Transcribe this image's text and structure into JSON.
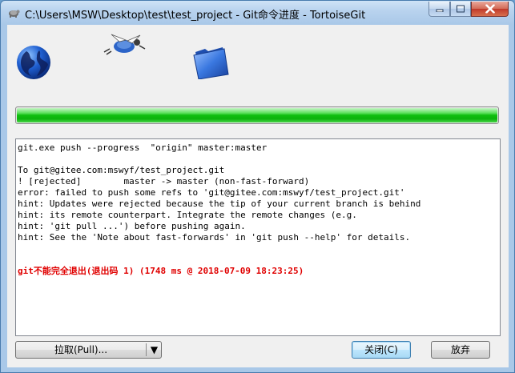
{
  "window": {
    "title": "C:\\Users\\MSW\\Desktop\\test\\test_project - Git命令进度 - TortoiseGit",
    "icon": "tortoisegit-icon"
  },
  "animation": {
    "icons": [
      "globe-icon",
      "flying-turtle-icon",
      "folder-icon"
    ]
  },
  "progress": {
    "fraction": 1.0,
    "color": "#0cb30c"
  },
  "log": {
    "lines": [
      "git.exe push --progress  \"origin\" master:master",
      "",
      "To git@gitee.com:mswyf/test_project.git",
      "! [rejected]        master -> master (non-fast-forward)",
      "error: failed to push some refs to 'git@gitee.com:mswyf/test_project.git'",
      "hint: Updates were rejected because the tip of your current branch is behind",
      "hint: its remote counterpart. Integrate the remote changes (e.g.",
      "hint: 'git pull ...') before pushing again.",
      "hint: See the 'Note about fast-forwards' in 'git push --help' for details.",
      "",
      "",
      "git不能完全退出(退出码 1) (1748 ms @ 2018-07-09 18:23:25)"
    ],
    "error_color": "#e00000"
  },
  "buttons": {
    "pull": "拉取(Pull)...",
    "pull_arrow": "▼",
    "close": "关闭(C)",
    "abort": "放弃"
  }
}
